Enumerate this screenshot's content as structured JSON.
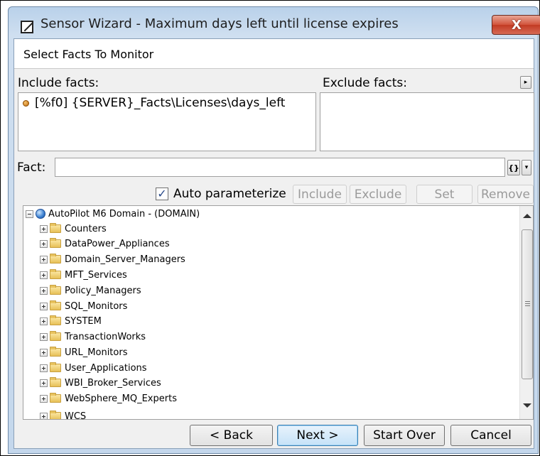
{
  "window": {
    "title": "Sensor Wizard - Maximum days left until license expires",
    "close_glyph": "X"
  },
  "step": {
    "heading": "Select Facts To Monitor"
  },
  "include": {
    "label": "Include facts:",
    "items": [
      "[%f0] {SERVER}_Facts\\Licenses\\days_left"
    ]
  },
  "exclude": {
    "label": "Exclude facts:",
    "items": []
  },
  "fact": {
    "label": "Fact:",
    "value": "",
    "params_glyph": "{}"
  },
  "options": {
    "auto_parameterize_label": "Auto parameterize",
    "auto_parameterize_checked": true
  },
  "actions": {
    "include": "Include",
    "exclude": "Exclude",
    "set": "Set",
    "remove": "Remove"
  },
  "tree": {
    "root": "AutoPilot M6 Domain - (DOMAIN)",
    "children": [
      "Counters",
      "DataPower_Appliances",
      "Domain_Server_Managers",
      "MFT_Services",
      "Policy_Managers",
      "SQL_Monitors",
      "SYSTEM",
      "TransactionWorks",
      "URL_Monitors",
      "User_Applications",
      "WBI_Broker_Services",
      "WebSphere_MQ_Experts",
      "WCS"
    ]
  },
  "footer": {
    "back": "< Back",
    "next": "Next >",
    "start_over": "Start Over",
    "cancel": "Cancel"
  },
  "icons": {
    "app": "wizard-icon",
    "folder": "folder-icon",
    "root": "globe-icon",
    "bullet": "fact-bullet-icon"
  },
  "colors": {
    "title_bar": "#b9d1ea",
    "close_button": "#c23b23",
    "primary_button_border": "#3c7fb1",
    "disabled_text": "#9a9a9a"
  }
}
